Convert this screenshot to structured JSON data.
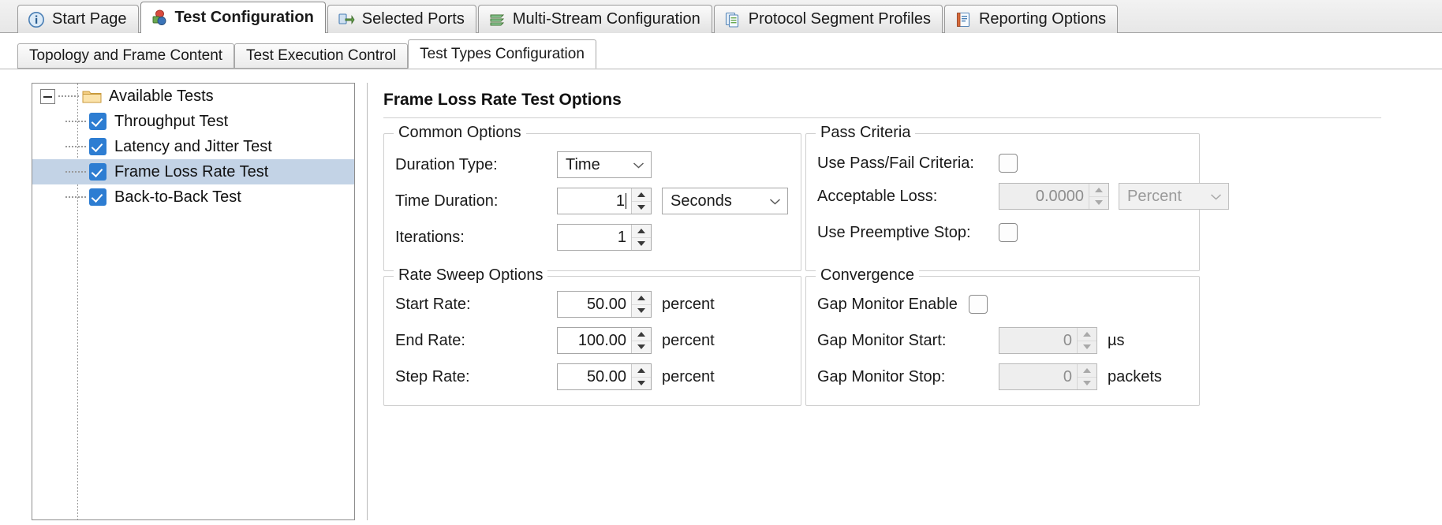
{
  "window": {
    "title": "Test Configuration"
  },
  "main_tabs": [
    {
      "label": "Start Page",
      "icon": "info-icon",
      "active": false
    },
    {
      "label": "Test Configuration",
      "icon": "test-config-icon",
      "active": true
    },
    {
      "label": "Selected Ports",
      "icon": "selected-ports-icon",
      "active": false
    },
    {
      "label": "Multi-Stream Configuration",
      "icon": "multi-stream-icon",
      "active": false
    },
    {
      "label": "Protocol Segment Profiles",
      "icon": "protocol-pages-icon",
      "active": false
    },
    {
      "label": "Reporting Options",
      "icon": "report-icon",
      "active": false
    }
  ],
  "sub_tabs": [
    {
      "label": "Topology and Frame Content",
      "active": false
    },
    {
      "label": "Test Execution Control",
      "active": false
    },
    {
      "label": "Test Types Configuration",
      "active": true
    }
  ],
  "tree": {
    "root": {
      "label": "Available Tests",
      "icon": "folder-icon",
      "expanded": true
    },
    "items": [
      {
        "label": "Throughput Test",
        "checked": true,
        "selected": false
      },
      {
        "label": "Latency and Jitter Test",
        "checked": true,
        "selected": false
      },
      {
        "label": "Frame Loss Rate Test",
        "checked": true,
        "selected": true
      },
      {
        "label": "Back-to-Back Test",
        "checked": true,
        "selected": false
      }
    ]
  },
  "panel": {
    "title": "Frame Loss Rate Test Options"
  },
  "common_options": {
    "legend": "Common Options",
    "duration_type": {
      "label": "Duration Type:",
      "value": "Time"
    },
    "time_duration": {
      "label": "Time Duration:",
      "value": "1",
      "unit_value": "Seconds",
      "focused": true
    },
    "iterations": {
      "label": "Iterations:",
      "value": "1"
    }
  },
  "rate_sweep_options": {
    "legend": "Rate Sweep Options",
    "start_rate": {
      "label": "Start Rate:",
      "value": "50.00",
      "unit": "percent"
    },
    "end_rate": {
      "label": "End Rate:",
      "value": "100.00",
      "unit": "percent"
    },
    "step_rate": {
      "label": "Step Rate:",
      "value": "50.00",
      "unit": "percent"
    }
  },
  "pass_criteria": {
    "legend": "Pass Criteria",
    "use_pass_fail": {
      "label": "Use Pass/Fail Criteria:",
      "checked": false
    },
    "acceptable_loss": {
      "label": "Acceptable Loss:",
      "value": "0.0000",
      "unit_value": "Percent",
      "disabled": true
    },
    "use_preemptive_stop": {
      "label": "Use Preemptive Stop:",
      "checked": false
    }
  },
  "convergence": {
    "legend": "Convergence",
    "gap_monitor_enable": {
      "label": "Gap Monitor Enable",
      "checked": false
    },
    "gap_monitor_start": {
      "label": "Gap Monitor Start:",
      "value": "0",
      "unit": "µs",
      "disabled": true
    },
    "gap_monitor_stop": {
      "label": "Gap Monitor Stop:",
      "value": "0",
      "unit": "packets",
      "disabled": true
    }
  },
  "colors": {
    "selection": "#c3d3e6",
    "checkbox_accent": "#2d7dd2",
    "folder": "#f0c070",
    "disabled_text": "#8e8e8e"
  }
}
